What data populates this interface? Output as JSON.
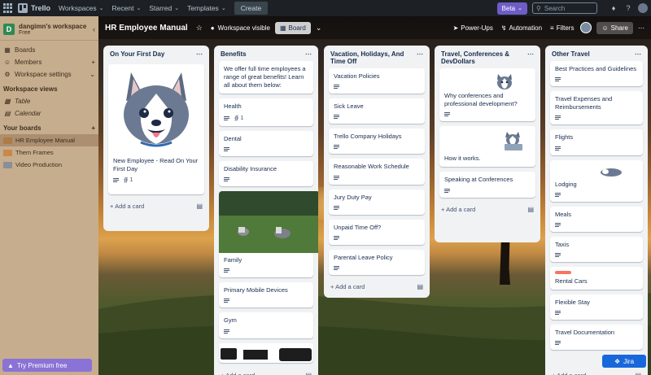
{
  "topbar": {
    "app_name": "Trello",
    "menus": [
      {
        "label": "Workspaces"
      },
      {
        "label": "Recent"
      },
      {
        "label": "Starred"
      },
      {
        "label": "Templates"
      }
    ],
    "create_label": "Create",
    "beta_label": "Beta",
    "search_placeholder": "Search"
  },
  "sidebar": {
    "workspace_name": "dangimn's workspace",
    "workspace_initial": "D",
    "plan": "Free",
    "items": [
      {
        "label": "Boards",
        "icon": "boards-icon"
      },
      {
        "label": "Members",
        "icon": "members-icon"
      },
      {
        "label": "Workspace settings",
        "icon": "gear-icon"
      }
    ],
    "views_heading": "Workspace views",
    "views": [
      {
        "label": "Table"
      },
      {
        "label": "Calendar"
      }
    ],
    "boards_heading": "Your boards",
    "boards": [
      {
        "label": "HR Employee Manual",
        "color": "#b07a45",
        "active": true
      },
      {
        "label": "Them Frames",
        "color": "#c9884a",
        "active": false
      },
      {
        "label": "Video Production",
        "color": "#8a8f96",
        "active": false
      }
    ],
    "premium_label": "Try Premium free"
  },
  "board": {
    "title": "HR Employee Manual",
    "visibility": "Workspace visible",
    "view_label": "Board",
    "powerups": "Power-Ups",
    "automation": "Automation",
    "filters": "Filters",
    "share": "Share"
  },
  "lists": [
    {
      "title": "On Your First Day",
      "cards": [
        {
          "title": "New Employee - Read On Your First Day",
          "attachments": "1"
        }
      ]
    },
    {
      "title": "Benefits",
      "cards": [
        {
          "title": "We offer full time employees a range of great benefits! Learn all about them below:"
        },
        {
          "title": "Health",
          "attachments": "1"
        },
        {
          "title": "Dental"
        },
        {
          "title": "Disability Insurance"
        },
        {
          "title": "Family"
        },
        {
          "title": "Primary Mobile Devices"
        },
        {
          "title": "Gym"
        }
      ]
    },
    {
      "title": "Vacation, Holidays, And Time Off",
      "cards": [
        {
          "title": "Vacation Policies"
        },
        {
          "title": "Sick Leave"
        },
        {
          "title": "Trello Company Holidays"
        },
        {
          "title": "Reasonable Work Schedule"
        },
        {
          "title": "Jury Duty Pay"
        },
        {
          "title": "Unpaid Time Off?"
        },
        {
          "title": "Parental Leave Policy"
        }
      ]
    },
    {
      "title": "Travel, Conferences & DevDollars",
      "cards": [
        {
          "title": "Why conferences and professional development?"
        },
        {
          "title": "How it works."
        },
        {
          "title": "Speaking at Conferences"
        }
      ]
    },
    {
      "title": "Other Travel",
      "cards": [
        {
          "title": "Best Practices and Guidelines"
        },
        {
          "title": "Travel Expenses and Reimbursements"
        },
        {
          "title": "Flights"
        },
        {
          "title": "Lodging"
        },
        {
          "title": "Meals"
        },
        {
          "title": "Taxis"
        },
        {
          "title": "Rental Cars"
        },
        {
          "title": "Flexible Stay"
        },
        {
          "title": "Travel Documentation"
        }
      ]
    }
  ],
  "add_card_label": "Add a card",
  "jira_label": "Jira",
  "colors": {
    "accent": "#6e5dc6",
    "topbar": "#1d2125",
    "label_red": "#f87462"
  }
}
